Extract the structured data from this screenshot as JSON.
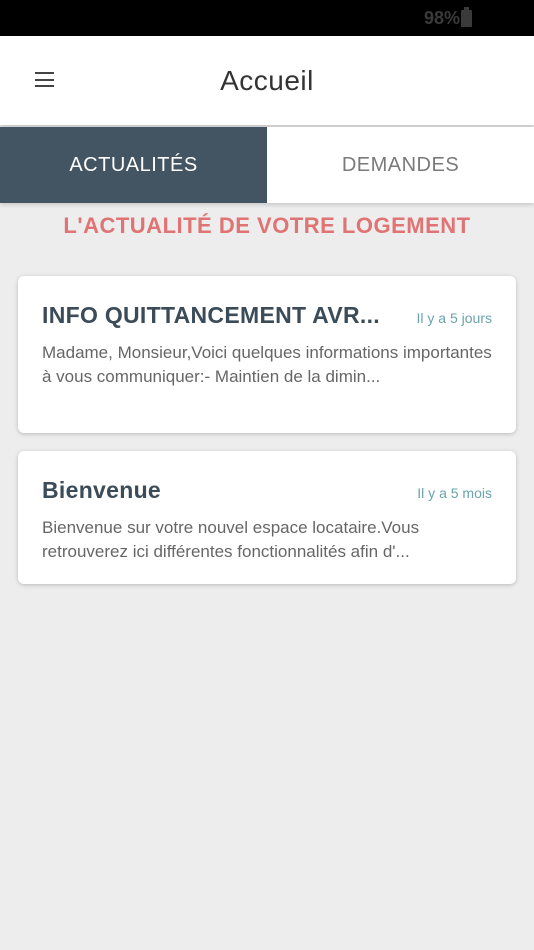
{
  "status_bar": {
    "battery_pct": "98%"
  },
  "header": {
    "title": "Accueil"
  },
  "tabs": [
    {
      "label": "ACTUALITÉS",
      "active": true
    },
    {
      "label": "DEMANDES",
      "active": false
    }
  ],
  "section": {
    "title": "L'ACTUALITÉ DE VOTRE LOGEMENT"
  },
  "news": [
    {
      "title": "INFO QUITTANCEMENT AVR...",
      "date": "Il y a 5 jours",
      "excerpt": "Madame, Monsieur,Voici quelques informations importantes à vous communiquer:- Maintien de la dimin..."
    },
    {
      "title": "Bienvenue",
      "date": "Il y a 5 mois",
      "excerpt": "Bienvenue sur votre nouvel espace locataire.Vous retrouverez ici différentes fonctionnalités afin d'..."
    }
  ],
  "colors": {
    "active_tab": "#435563",
    "section_title": "#e07373",
    "date": "#6aa3ad"
  }
}
